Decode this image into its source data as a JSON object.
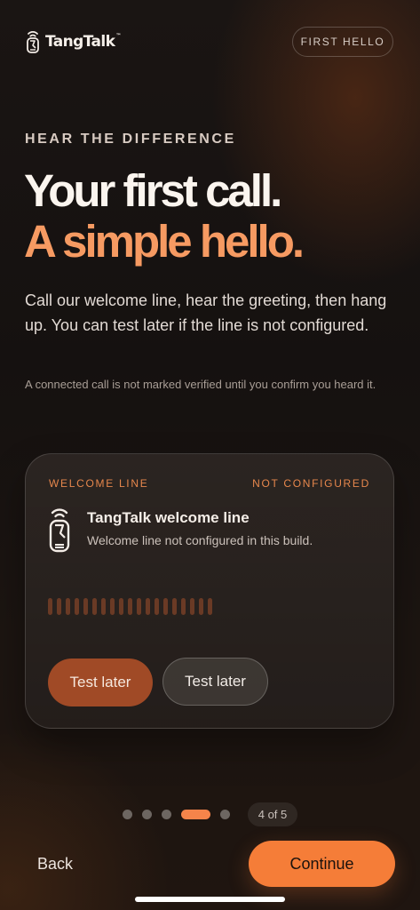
{
  "header": {
    "logo_text": "TangTalk",
    "logo_tm": "™",
    "logo_icon": "phone-wave-icon",
    "step_pill": "FIRST HELLO"
  },
  "hero": {
    "eyebrow": "HEAR THE DIFFERENCE",
    "title_line1": "Your first call.",
    "title_line2": "A simple hello.",
    "body": "Call our welcome line, hear the greeting, then hang up. You can test later if the line is not configured.",
    "note": "A connected call is not marked verified until you confirm you heard it."
  },
  "card": {
    "label": "WELCOME LINE",
    "status": "NOT CONFIGURED",
    "icon": "phone-wave-icon",
    "title": "TangTalk welcome line",
    "subtitle": "Welcome line not configured in this build.",
    "primary_button": "Test later",
    "secondary_button": "Test later"
  },
  "progress": {
    "total": 5,
    "current": 4,
    "label": "4 of 5"
  },
  "footer": {
    "back_label": "Back",
    "continue_label": "Continue"
  },
  "colors": {
    "accent": "#f57d38",
    "accent_headline": "#f69a62",
    "accent_label": "#e6874c",
    "background": "#1a1513"
  }
}
